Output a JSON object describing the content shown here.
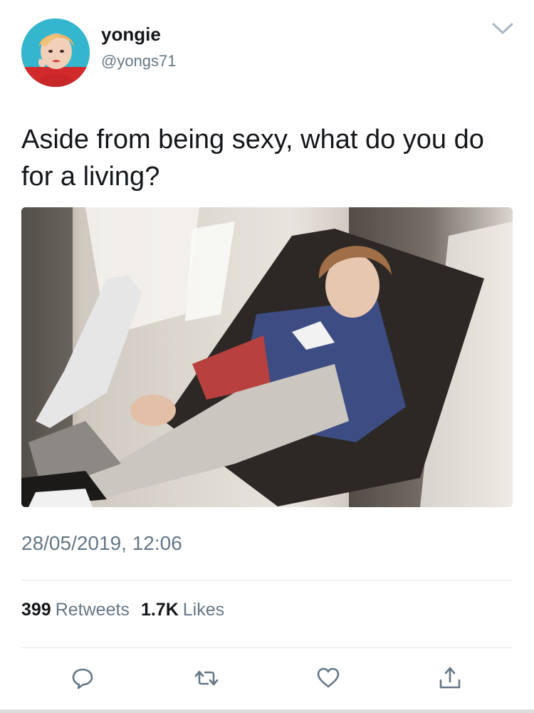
{
  "tweet": {
    "author": {
      "display_name": "yongie",
      "handle": "@yongs71",
      "avatar_icon": "profile-photo"
    },
    "menu_icon": "chevron-down-icon",
    "text": "Aside from being sexy, what do you do for a living?",
    "media": {
      "icon": "photo",
      "description_visible": false
    },
    "timestamp": "28/05/2019, 12:06",
    "stats": {
      "retweets_count": "399",
      "retweets_label": "Retweets",
      "likes_count": "1.7K",
      "likes_label": "Likes"
    },
    "actions": [
      {
        "icon": "reply-icon"
      },
      {
        "icon": "retweet-icon"
      },
      {
        "icon": "like-icon"
      },
      {
        "icon": "share-icon"
      }
    ]
  },
  "colors": {
    "text_primary": "#14171a",
    "text_secondary": "#657786",
    "divider": "#e1e8ed"
  }
}
